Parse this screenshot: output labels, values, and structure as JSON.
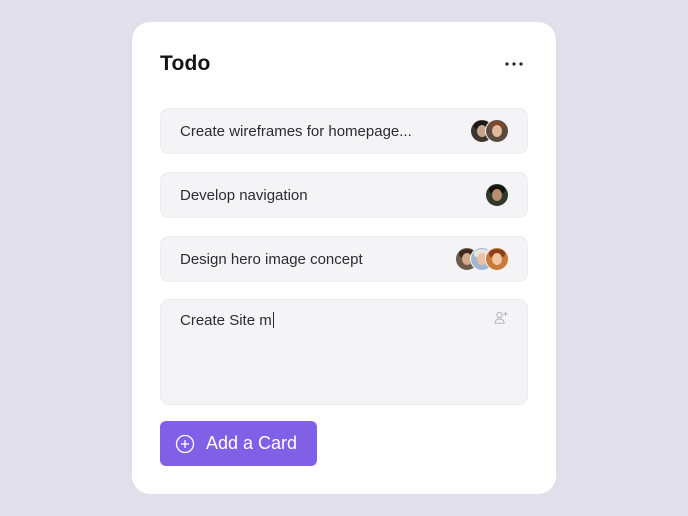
{
  "list": {
    "title": "Todo",
    "menu_icon": "more-horizontal-icon"
  },
  "cards": [
    {
      "text": "Create wireframes for homepage...",
      "assignee_count": 2
    },
    {
      "text": "Develop navigation",
      "assignee_count": 1
    },
    {
      "text": "Design hero image concept",
      "assignee_count": 3
    }
  ],
  "new_card": {
    "value": "Create Site m",
    "assign_icon": "add-user-icon"
  },
  "add_button": {
    "label": "Add a Card",
    "icon": "plus-circle-icon"
  },
  "colors": {
    "background": "#e1dfe9",
    "panel": "#ffffff",
    "card": "#f4f4f6",
    "accent": "#8160e8"
  }
}
